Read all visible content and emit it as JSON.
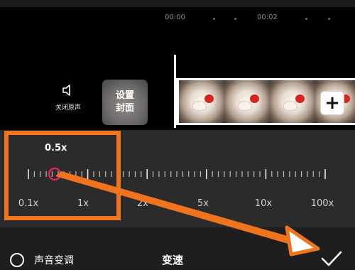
{
  "timeline": {
    "timecodes": [
      "00:00",
      "00:02"
    ]
  },
  "tools": {
    "mute_label": "关闭原声",
    "cover_line1": "设置",
    "cover_line2": "封面",
    "add_clip_symbol": "+"
  },
  "speed_panel": {
    "current_value": "0.5x",
    "min": 0.1,
    "max": 100,
    "current": 0.5,
    "labels": [
      "0.1x",
      "1x",
      "2x",
      "5x",
      "10x",
      "100x"
    ]
  },
  "bottom_bar": {
    "pitch_label": "声音变调",
    "title": "变速"
  },
  "colors": {
    "accent_orange": "#f0731e",
    "slider_handle": "#e0245e",
    "panel_bg": "#2b2b2b"
  },
  "icons": [
    "speaker-icon",
    "plus-icon",
    "checkmark-icon",
    "arrow-annotation"
  ]
}
